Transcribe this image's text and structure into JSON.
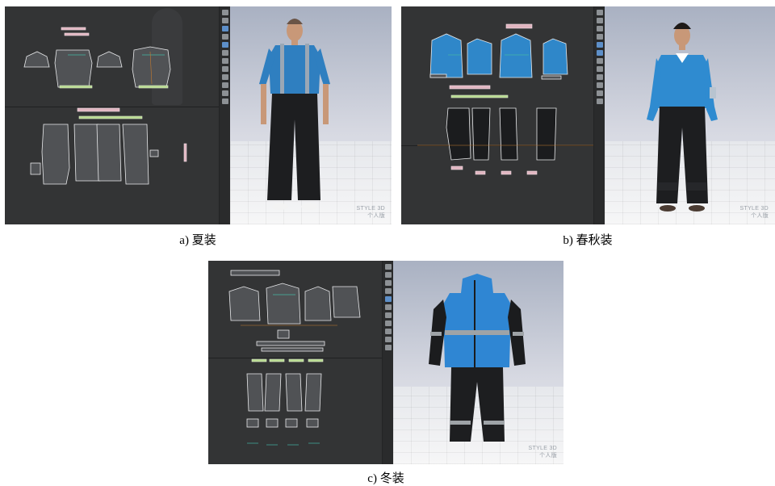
{
  "figure": {
    "panels": [
      {
        "id": "a",
        "caption": "a) 夏装",
        "watermark": [
          "STYLE 3D",
          "个人版"
        ],
        "garment_colors": {
          "top": "#2f7fc0",
          "bottom": "#1d1e20"
        }
      },
      {
        "id": "b",
        "caption": "b) 春秋装",
        "watermark": [
          "STYLE 3D",
          "个人版"
        ],
        "garment_colors": {
          "top": "#2f8bd0",
          "bottom": "#1d1e20"
        }
      },
      {
        "id": "c",
        "caption": "c) 冬装",
        "watermark": [
          "STYLE 3D",
          "个人版"
        ],
        "garment_colors": {
          "top": "#2f86d3",
          "bottom": "#1d1e20",
          "reflective": "#9ea3a7"
        }
      }
    ],
    "ui_colors": {
      "pattern_bg": "#333435",
      "toolbar_bg": "#2a2b2c",
      "active_tool": "#5d8fc9",
      "seam": "#43b7a4"
    }
  }
}
